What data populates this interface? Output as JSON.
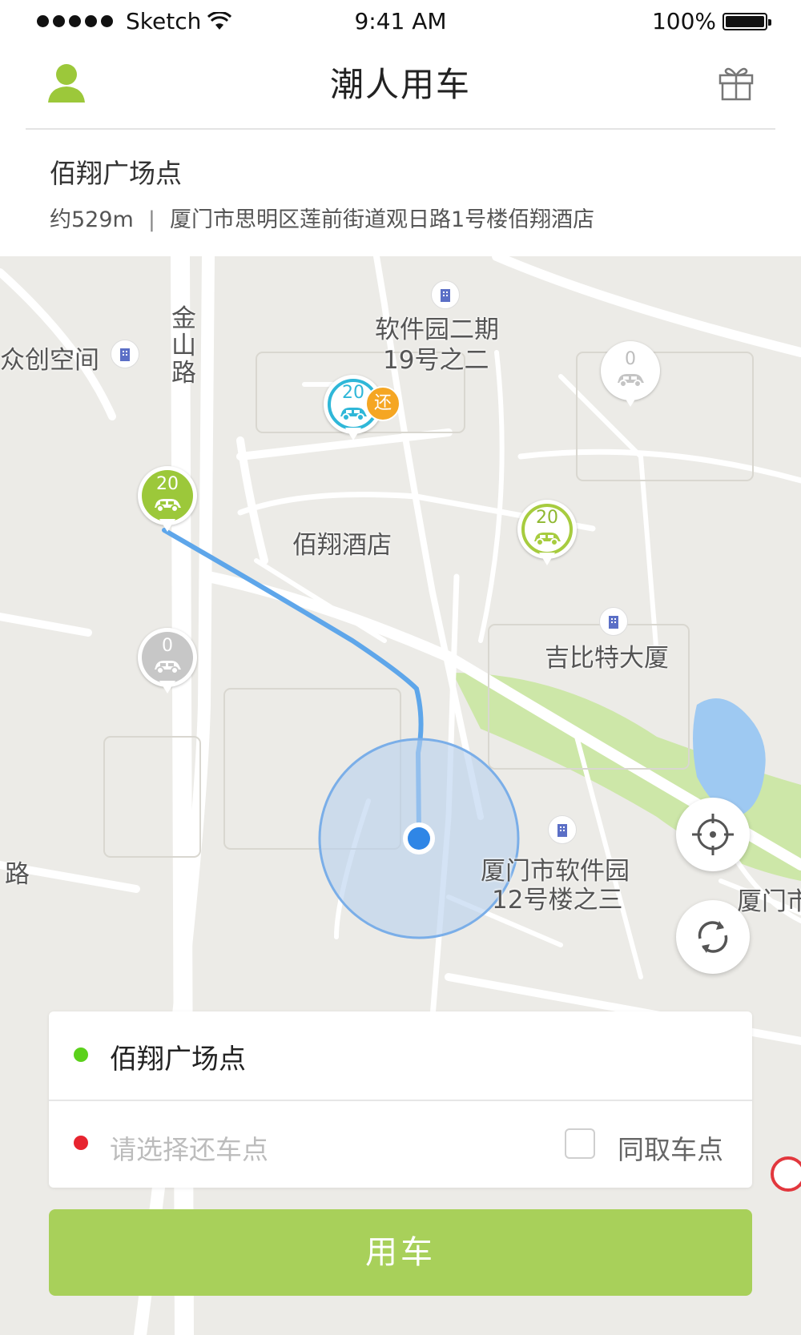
{
  "status_bar": {
    "carrier": "Sketch",
    "time": "9:41 AM",
    "battery": "100%",
    "battery_level": 1.0
  },
  "header": {
    "title": "潮人用车",
    "left_icon": "user-icon",
    "right_icon": "gift-icon"
  },
  "station": {
    "name": "佰翔广场点",
    "distance": "约529m",
    "separator": "|",
    "address": "厦门市思明区莲前街道观日路1号楼佰翔酒店"
  },
  "map": {
    "labels": {
      "software_park_2": "软件园二期",
      "no19": "19号之二",
      "crowd_space": "众创空间",
      "jinshan_road_1": "金",
      "jinshan_road_2": "山",
      "jinshan_road_3": "路",
      "hotel": "佰翔酒店",
      "jupiter": "吉比特大厦",
      "xm_park": "厦门市软件园",
      "no12": "12号楼之三",
      "road_left": "路",
      "xiamen_edge": "厦门市"
    },
    "markers": [
      {
        "name": "marker-blue-20",
        "count": "20",
        "style": "cyan"
      },
      {
        "name": "marker-green-20",
        "count": "20",
        "style": "green"
      },
      {
        "name": "marker-lime-20",
        "count": "20",
        "style": "lime"
      },
      {
        "name": "marker-white-0",
        "count": "0",
        "style": "white"
      },
      {
        "name": "marker-gray-0",
        "count": "0",
        "style": "gray"
      }
    ],
    "return_badge": "还",
    "colors": {
      "route": "#5ea6ea",
      "accuracy_circle": "#b7d0ef",
      "location_dot": "#2f86e6",
      "park_green": "#cde7a8",
      "water": "#9ec9f2"
    }
  },
  "buttons": {
    "locate_icon": "crosshair-icon",
    "refresh_icon": "refresh-icon"
  },
  "booking": {
    "pickup": "佰翔广场点",
    "return_placeholder": "请选择还车点",
    "same_point_label": "同取车点",
    "same_point_checked": false,
    "submit": "用车"
  },
  "colors": {
    "primary": "#a8d05a",
    "pickup_dot": "#5bd11b",
    "return_dot": "#e7242f"
  }
}
